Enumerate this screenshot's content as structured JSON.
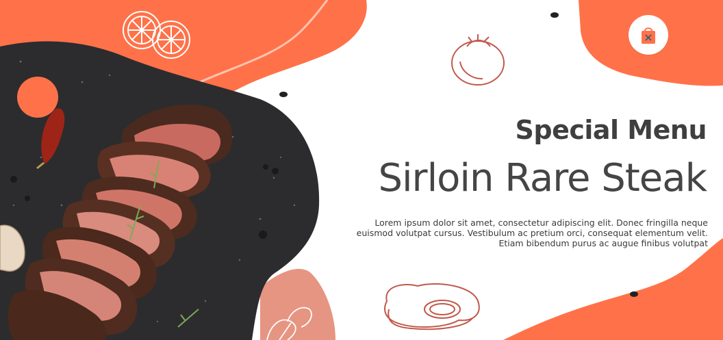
{
  "hero": {
    "eyebrow": "Special Menu",
    "title": "Sirloin Rare Steak",
    "description": "Lorem ipsum dolor sit amet, consectetur adipiscing elit. Donec fringilla neque euismod volutpat cursus. Vestibulum ac pretium orci, consequat elementum velit. Etiam bibendum purus ac augue finibus volutpat"
  },
  "cart": {
    "icon": "shopping-bag-icon"
  },
  "colors": {
    "accent": "#ff7249",
    "accent_soft": "#e69582",
    "slate": "#2c2c2e",
    "text_dark": "#444444",
    "sketch": "#c0584a"
  }
}
